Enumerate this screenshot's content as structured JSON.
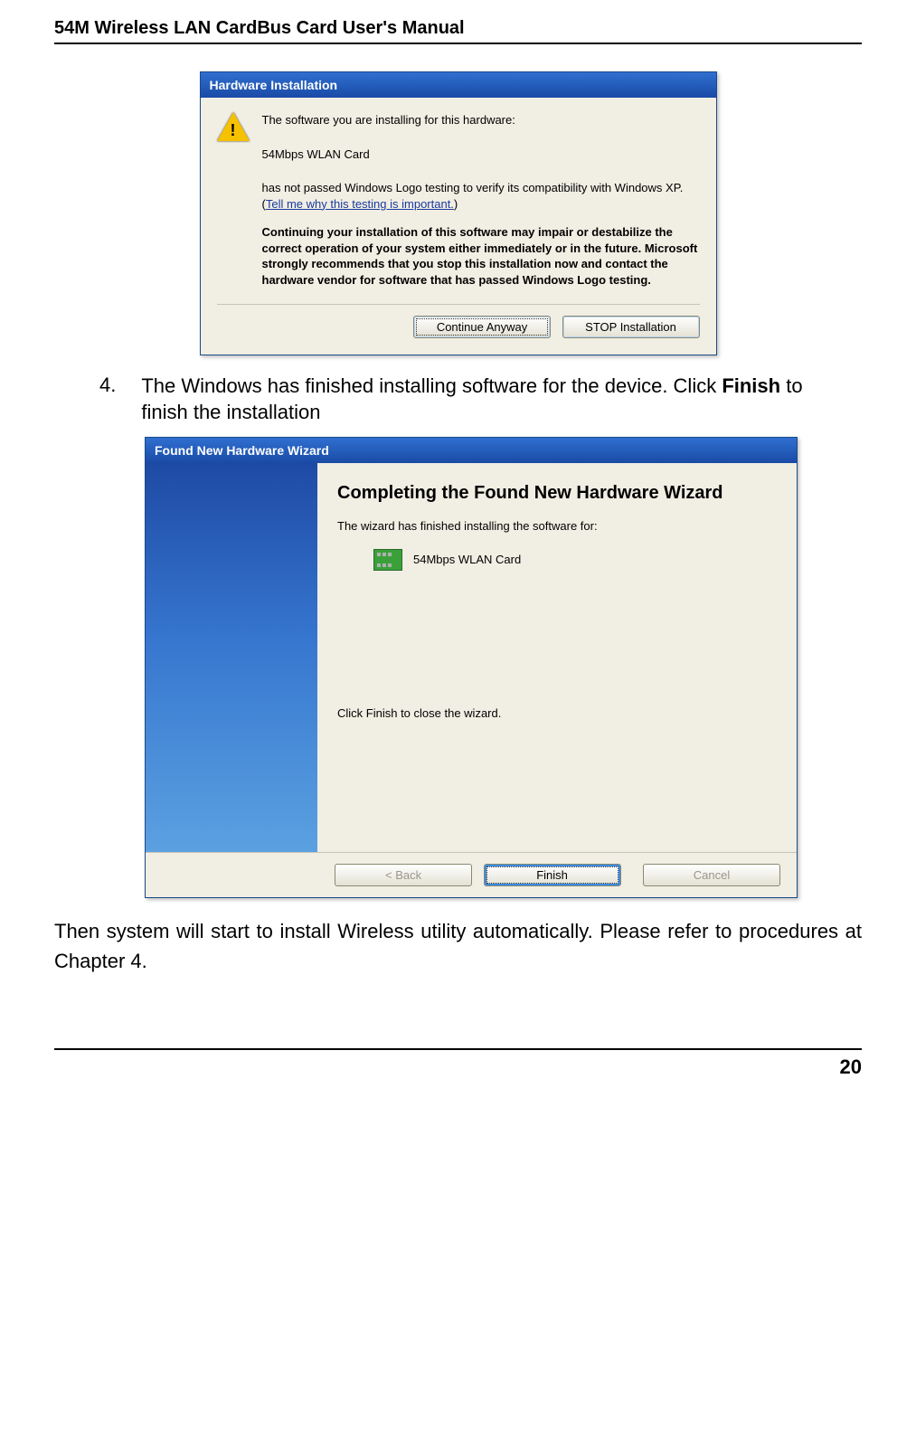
{
  "header_title": "54M Wireless LAN CardBus Card User's Manual",
  "dialog1": {
    "title": "Hardware Installation",
    "intro": "The software you are installing for this hardware:",
    "device": "54Mbps WLAN Card",
    "compat_line": "has not passed Windows Logo testing to verify its compatibility with Windows XP. (",
    "link_text": "Tell me why this testing is important.",
    "compat_end": ")",
    "warning": "Continuing your installation of this software may impair or destabilize the correct operation of your system either immediately or in the future. Microsoft strongly recommends that you stop this installation now and contact the hardware vendor for software that has passed Windows Logo testing.",
    "btn_continue": "Continue Anyway",
    "btn_stop": "STOP Installation"
  },
  "step": {
    "number": "4.",
    "text_a": "The Windows has finished installing software for the device. Click ",
    "text_bold": "Finish",
    "text_b": " to finish the installation"
  },
  "wizard": {
    "title": "Found New Hardware Wizard",
    "heading": "Completing the Found New Hardware Wizard",
    "line1": "The wizard has finished installing the software for:",
    "device": "54Mbps WLAN Card",
    "line2": "Click Finish to close the wizard.",
    "btn_back": "< Back",
    "btn_finish": "Finish",
    "btn_cancel": "Cancel"
  },
  "follow_text": "Then system will start to install Wireless utility automatically. Please refer to procedures at Chapter 4.",
  "page_number": "20"
}
